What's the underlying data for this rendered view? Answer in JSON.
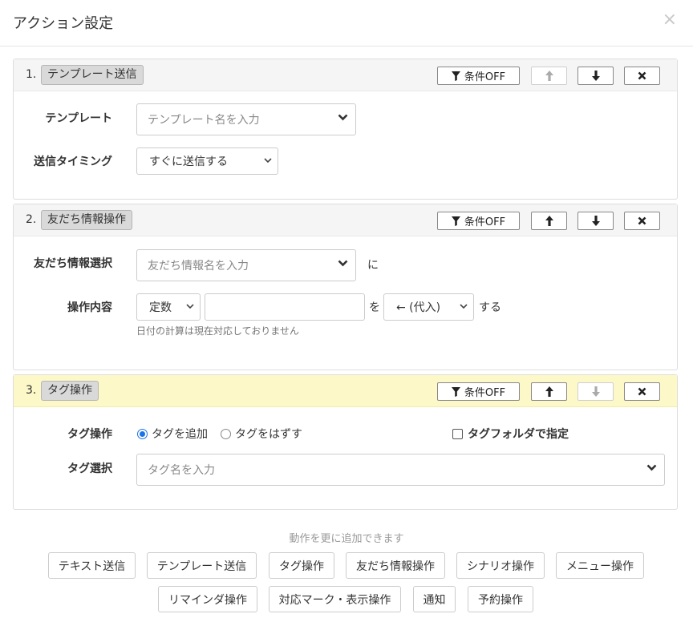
{
  "dialog": {
    "title": "アクション設定",
    "close_symbol": "×"
  },
  "actions": [
    {
      "number": "1.",
      "label": "テンプレート送信",
      "condition_label": "条件OFF",
      "template_label": "テンプレート",
      "template_placeholder": "テンプレート名を入力",
      "timing_label": "送信タイミング",
      "timing_value": "すぐに送信する"
    },
    {
      "number": "2.",
      "label": "友だち情報操作",
      "condition_label": "条件OFF",
      "select_label": "友だち情報選択",
      "select_placeholder": "友だち情報名を入力",
      "select_suffix": "に",
      "op_label": "操作内容",
      "type_value": "定数",
      "value_input": "",
      "particle": "を",
      "op_value": "← (代入)",
      "op_suffix": "する",
      "hint": "日付の計算は現在対応しておりません"
    },
    {
      "number": "3.",
      "label": "タグ操作",
      "condition_label": "条件OFF",
      "tag_op_label": "タグ操作",
      "radio_add": "タグを追加",
      "radio_remove": "タグをはずす",
      "selected_option": "タグを追加",
      "folder_checkbox": "タグフォルダで指定",
      "tag_select_label": "タグ選択",
      "tag_placeholder": "タグ名を入力"
    }
  ],
  "add_section": {
    "hint": "動作を更に追加できます",
    "row1": [
      "テキスト送信",
      "テンプレート送信",
      "タグ操作",
      "友だち情報操作",
      "シナリオ操作",
      "メニュー操作"
    ],
    "row2": [
      "リマインダ操作",
      "対応マーク・表示操作",
      "通知",
      "予約操作"
    ]
  },
  "colors": {
    "highlight_header": "#fcf8c8",
    "radio_accent": "#1a73e8",
    "header_gray": "#f5f5f5"
  }
}
